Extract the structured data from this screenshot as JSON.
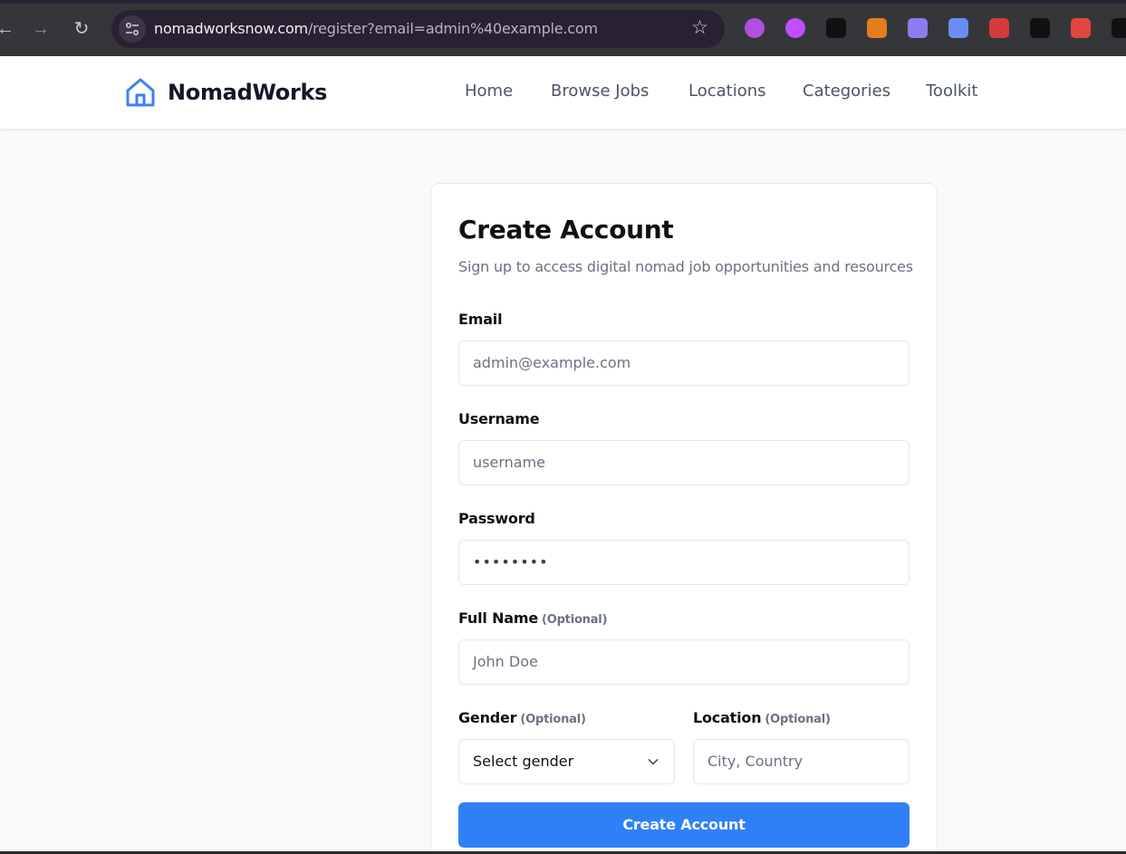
{
  "browser": {
    "url_host": "nomadworksnow.com",
    "url_path": "/register?email=admin%40example.com",
    "extensions": [
      {
        "icon": "extension-circle-icon",
        "color": "#b04fe0"
      },
      {
        "icon": "extension-target-icon",
        "color": "#c24dff"
      },
      {
        "icon": "x-icon",
        "color": "#111111"
      },
      {
        "icon": "extension-s-icon",
        "color": "#e57c1d"
      },
      {
        "icon": "ghost-icon",
        "color": "#8b7cf0"
      },
      {
        "icon": "extension-arrow-icon",
        "color": "#6a8cf5"
      },
      {
        "icon": "extension-me-icon",
        "color": "#d43b3b"
      },
      {
        "icon": "extension-dice-icon",
        "color": "#111111"
      },
      {
        "icon": "backpack-icon",
        "color": "#e0463f"
      },
      {
        "icon": "extension-text-icon",
        "color": "#111111"
      }
    ]
  },
  "header": {
    "logo_text": "NomadWorks",
    "nav": [
      "Home",
      "Browse Jobs",
      "Locations",
      "Categories",
      "Toolkit"
    ]
  },
  "form": {
    "title": "Create Account",
    "subtitle": "Sign up to access digital nomad job opportunities and resources",
    "email_label": "Email",
    "email_value": "admin@example.com",
    "username_label": "Username",
    "username_placeholder": "username",
    "password_label": "Password",
    "password_value": "••••••••",
    "fullname_label": "Full Name",
    "optional_tag": "(Optional)",
    "fullname_placeholder": "John Doe",
    "gender_label": "Gender",
    "gender_value": "Select gender",
    "location_label": "Location",
    "location_placeholder": "City, Country",
    "submit_label": "Create Account"
  },
  "colors": {
    "accent": "#2f80f6",
    "logo_blue": "#3b82f6"
  }
}
